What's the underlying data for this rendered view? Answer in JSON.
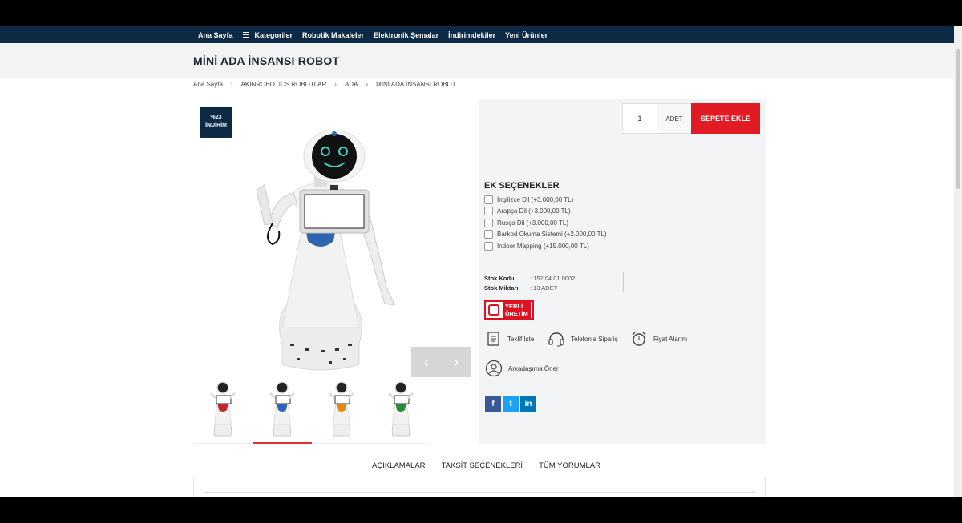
{
  "nav": {
    "items": [
      "Ana Sayfa",
      "Kategoriler",
      "Robotik Makaleler",
      "Elektronik Şemalar",
      "İndirimdekiler",
      "Yeni Ürünler"
    ]
  },
  "page_title": "MİNİ ADA İNSANSI ROBOT",
  "breadcrumb": [
    "Ana Sayfa",
    "AKINROBOTICS ROBOTLAR",
    "ADA",
    "MİNİ ADA İNSANSI ROBOT"
  ],
  "badge": {
    "line1": "%23",
    "line2": "İNDİRİM"
  },
  "gallery": {
    "prev": "‹",
    "next": "›",
    "active_index": 1,
    "thumb_colors": [
      "#c0272d",
      "#2f64b0",
      "#e08a1e",
      "#2e8b3a"
    ]
  },
  "cart": {
    "quantity": "1",
    "unit": "ADET",
    "add_label": "SEPETE EKLE"
  },
  "options": {
    "title": "EK SEÇENEKLER",
    "items": [
      "İngilizce Dil (+3.000,00 TL)",
      "Arapça Dil (+3.000,00 TL)",
      "Rusça Dil (+3.000,00 TL)",
      "Barkod Okuma Sistemi (+2.000,00 TL)",
      "Indoor Mapping (+15.000,00 TL)"
    ]
  },
  "stock": {
    "code_label": "Stok Kodu",
    "code_value": ": 152.04.01.0002",
    "qty_label": "Stok Miktarı",
    "qty_value": ": 13 ADET"
  },
  "origin": {
    "line1": "YERLİ",
    "line2": "ÜRETİM"
  },
  "actions": {
    "quote": "Teklif İste",
    "phone": "Telefonla Sipariş",
    "alarm": "Fiyat Alarmı",
    "suggest": "Arkadaşıma Öner"
  },
  "social": {
    "facebook": "f",
    "twitter": "t",
    "linkedin": "in"
  },
  "tabs": [
    "AÇIKLAMALAR",
    "TAKSİT SEÇENEKLERİ",
    "TÜM YORUMLAR"
  ],
  "colors": {
    "navy": "#0d2a44",
    "accent": "#e01b24"
  }
}
